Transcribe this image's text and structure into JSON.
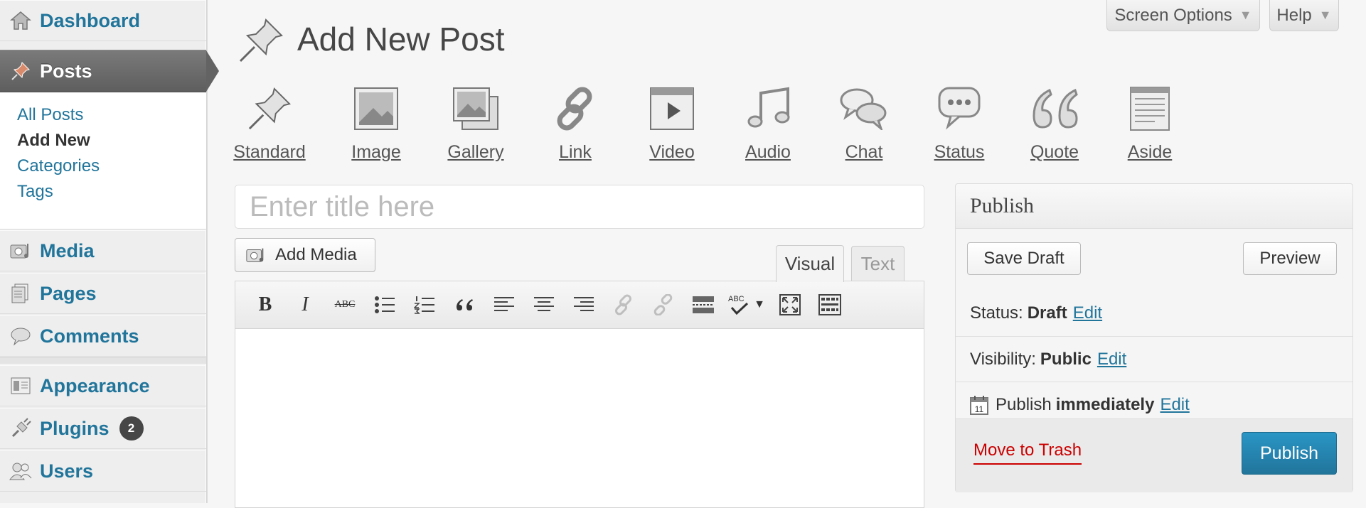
{
  "sidebar": {
    "items": [
      {
        "label": "Dashboard",
        "icon": "house-icon"
      },
      {
        "label": "Posts",
        "icon": "pushpin-icon"
      },
      {
        "label": "Media",
        "icon": "camera-music-icon"
      },
      {
        "label": "Pages",
        "icon": "pages-icon"
      },
      {
        "label": "Comments",
        "icon": "speech-bubble-icon"
      },
      {
        "label": "Appearance",
        "icon": "layout-icon"
      },
      {
        "label": "Plugins",
        "icon": "plug-icon",
        "badge": "2"
      },
      {
        "label": "Users",
        "icon": "users-icon"
      }
    ],
    "posts_submenu": [
      "All Posts",
      "Add New",
      "Categories",
      "Tags"
    ]
  },
  "top_buttons": {
    "screen_options": "Screen Options",
    "help": "Help"
  },
  "page_title": "Add New Post",
  "formats": [
    "Standard",
    "Image",
    "Gallery",
    "Link",
    "Video",
    "Audio",
    "Chat",
    "Status",
    "Quote",
    "Aside"
  ],
  "title_field": {
    "placeholder": "Enter title here",
    "value": ""
  },
  "add_media": "Add Media",
  "editor_tabs": {
    "visual": "Visual",
    "text": "Text"
  },
  "toolbar": {
    "bold": "B",
    "italic": "I",
    "strike": "ABC"
  },
  "publish": {
    "heading": "Publish",
    "save_draft": "Save Draft",
    "preview": "Preview",
    "status_label": "Status:",
    "status_value": "Draft",
    "visibility_label": "Visibility:",
    "visibility_value": "Public",
    "schedule_label": "Publish",
    "schedule_value": "immediately",
    "edit": "Edit",
    "trash": "Move to Trash",
    "publish_button": "Publish"
  },
  "colors": {
    "link": "#21759b",
    "primary_button": "#21759b",
    "trash": "#cc0000",
    "badge": "#464646"
  }
}
